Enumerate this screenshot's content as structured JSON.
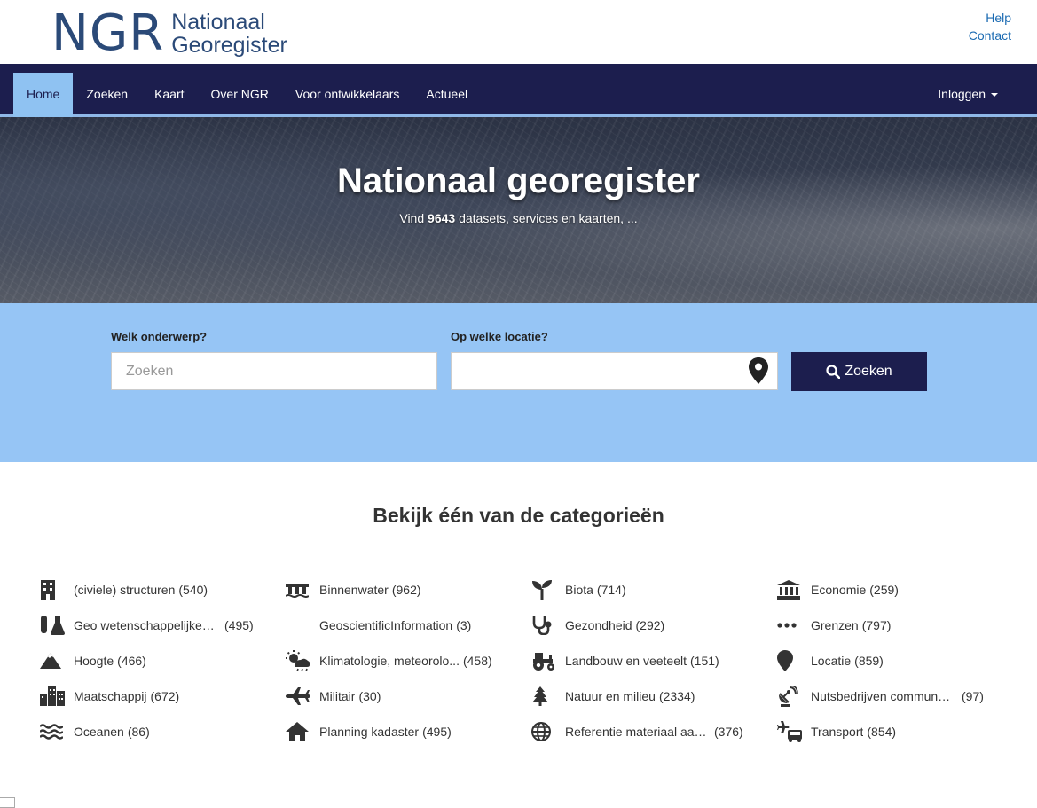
{
  "header": {
    "logo_abbr": "NGR",
    "logo_line1": "Nationaal",
    "logo_line2": "Georegister",
    "links": [
      "Help",
      "Contact"
    ]
  },
  "nav": {
    "items": [
      "Home",
      "Zoeken",
      "Kaart",
      "Over NGR",
      "Voor ontwikkelaars",
      "Actueel"
    ],
    "active": "Home",
    "login": "Inloggen"
  },
  "hero": {
    "title": "Nationaal georegister",
    "sub_prefix": "Vind ",
    "count": "9643",
    "sub_suffix": " datasets, services en kaarten, ..."
  },
  "search": {
    "topic_label": "Welk onderwerp?",
    "topic_placeholder": "Zoeken",
    "topic_value": "",
    "location_label": "Op welke locatie?",
    "location_value": "",
    "button_label": "Zoeken"
  },
  "categories": {
    "title": "Bekijk één van de categorieën",
    "items": [
      {
        "label": "(civiele) structuren",
        "count": "(540)",
        "icon": "building-icon"
      },
      {
        "label": "Binnenwater",
        "count": "(962)",
        "icon": "bridge-icon"
      },
      {
        "label": "Biota",
        "count": "(714)",
        "icon": "sprout-icon"
      },
      {
        "label": "Economie",
        "count": "(259)",
        "icon": "bank-icon"
      },
      {
        "label": "Geo wetenschappelijke ...",
        "count": "(495)",
        "icon": "lab-icon"
      },
      {
        "label": "GeoscientificInformation",
        "count": "(3)",
        "icon": ""
      },
      {
        "label": "Gezondheid",
        "count": "(292)",
        "icon": "stethoscope-icon"
      },
      {
        "label": "Grenzen",
        "count": "(797)",
        "icon": "dots-icon"
      },
      {
        "label": "Hoogte",
        "count": "(466)",
        "icon": "mountain-icon"
      },
      {
        "label": "Klimatologie, meteorolo...",
        "count": "(458)",
        "icon": "weather-icon"
      },
      {
        "label": "Landbouw en veeteelt",
        "count": "(151)",
        "icon": "tractor-icon"
      },
      {
        "label": "Locatie",
        "count": "(859)",
        "icon": "map-pin-icon"
      },
      {
        "label": "Maatschappij",
        "count": "(672)",
        "icon": "city-icon"
      },
      {
        "label": "Militair",
        "count": "(30)",
        "icon": "plane-icon"
      },
      {
        "label": "Natuur en milieu",
        "count": "(2334)",
        "icon": "tree-icon"
      },
      {
        "label": "Nutsbedrijven communic...",
        "count": "(97)",
        "icon": "satellite-icon"
      },
      {
        "label": "Oceanen",
        "count": "(86)",
        "icon": "waves-icon"
      },
      {
        "label": "Planning kadaster",
        "count": "(495)",
        "icon": "house-icon"
      },
      {
        "label": "Referentie materiaal aar...",
        "count": "(376)",
        "icon": "globe-icon"
      },
      {
        "label": "Transport",
        "count": "(854)",
        "icon": "transport-icon"
      }
    ]
  },
  "colors": {
    "nav_bg": "#1c1e4e",
    "nav_active": "#8fc2f2",
    "search_bg": "#96c5f5",
    "link": "#1a6ab2"
  }
}
